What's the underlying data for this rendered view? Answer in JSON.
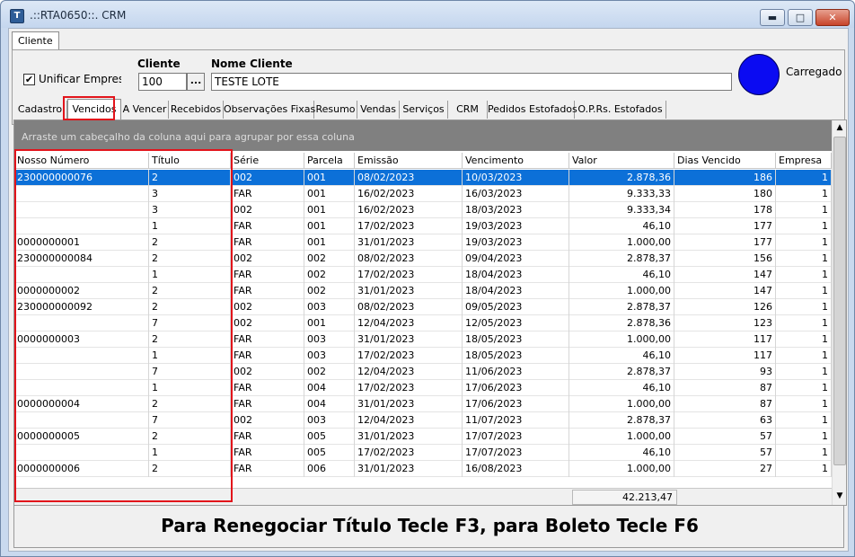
{
  "window": {
    "title": ".::RTA0650::. CRM",
    "icon": "app-logo-icon",
    "min": "▬",
    "max": "□",
    "close": "✕"
  },
  "top_tab": "Cliente",
  "form": {
    "unificar_checked": true,
    "unificar_mark": "✔",
    "unificar_label": "Unificar Empresas",
    "cliente_label": "Cliente",
    "cliente_value": "100",
    "lookup_label": "...",
    "nome_label": "Nome Cliente",
    "nome_value": "TESTE LOTE",
    "status_text": "Carregado",
    "status_color": "#0b0bf2"
  },
  "tabs": [
    "Cadastro",
    "Vencidos",
    "A Vencer",
    "Recebidos",
    "Observações Fixas",
    "Resumo",
    "Vendas",
    "Serviços",
    "CRM",
    "Pedidos Estofados",
    "O.P.Rs. Estofados"
  ],
  "active_tab": "Vencidos",
  "grid": {
    "group_hint": "Arraste um cabeçalho da coluna aqui para agrupar por essa coluna",
    "columns": [
      "Nosso Número",
      "Título",
      "Série",
      "Parcela",
      "Emissão",
      "Vencimento",
      "Valor",
      "Dias Vencido",
      "Empresa"
    ],
    "rows": [
      [
        "230000000076",
        "2",
        "002",
        "001",
        "08/02/2023",
        "10/03/2023",
        "2.878,36",
        "186",
        "1"
      ],
      [
        "",
        "3",
        "FAR",
        "001",
        "16/02/2023",
        "16/03/2023",
        "9.333,33",
        "180",
        "1"
      ],
      [
        "",
        "3",
        "002",
        "001",
        "16/02/2023",
        "18/03/2023",
        "9.333,34",
        "178",
        "1"
      ],
      [
        "",
        "1",
        "FAR",
        "001",
        "17/02/2023",
        "19/03/2023",
        "46,10",
        "177",
        "1"
      ],
      [
        "0000000001",
        "2",
        "FAR",
        "001",
        "31/01/2023",
        "19/03/2023",
        "1.000,00",
        "177",
        "1"
      ],
      [
        "230000000084",
        "2",
        "002",
        "002",
        "08/02/2023",
        "09/04/2023",
        "2.878,37",
        "156",
        "1"
      ],
      [
        "",
        "1",
        "FAR",
        "002",
        "17/02/2023",
        "18/04/2023",
        "46,10",
        "147",
        "1"
      ],
      [
        "0000000002",
        "2",
        "FAR",
        "002",
        "31/01/2023",
        "18/04/2023",
        "1.000,00",
        "147",
        "1"
      ],
      [
        "230000000092",
        "2",
        "002",
        "003",
        "08/02/2023",
        "09/05/2023",
        "2.878,37",
        "126",
        "1"
      ],
      [
        "",
        "7",
        "002",
        "001",
        "12/04/2023",
        "12/05/2023",
        "2.878,36",
        "123",
        "1"
      ],
      [
        "0000000003",
        "2",
        "FAR",
        "003",
        "31/01/2023",
        "18/05/2023",
        "1.000,00",
        "117",
        "1"
      ],
      [
        "",
        "1",
        "FAR",
        "003",
        "17/02/2023",
        "18/05/2023",
        "46,10",
        "117",
        "1"
      ],
      [
        "",
        "7",
        "002",
        "002",
        "12/04/2023",
        "11/06/2023",
        "2.878,37",
        "93",
        "1"
      ],
      [
        "",
        "1",
        "FAR",
        "004",
        "17/02/2023",
        "17/06/2023",
        "46,10",
        "87",
        "1"
      ],
      [
        "0000000004",
        "2",
        "FAR",
        "004",
        "31/01/2023",
        "17/06/2023",
        "1.000,00",
        "87",
        "1"
      ],
      [
        "",
        "7",
        "002",
        "003",
        "12/04/2023",
        "11/07/2023",
        "2.878,37",
        "63",
        "1"
      ],
      [
        "0000000005",
        "2",
        "FAR",
        "005",
        "31/01/2023",
        "17/07/2023",
        "1.000,00",
        "57",
        "1"
      ],
      [
        "",
        "1",
        "FAR",
        "005",
        "17/02/2023",
        "17/07/2023",
        "46,10",
        "57",
        "1"
      ],
      [
        "0000000006",
        "2",
        "FAR",
        "006",
        "31/01/2023",
        "16/08/2023",
        "1.000,00",
        "27",
        "1"
      ]
    ],
    "selected_row": 0,
    "total_valor": "42.213,47"
  },
  "scroll": {
    "up": "▲",
    "down": "▼"
  },
  "hint": "Para Renegociar Título Tecle F3, para Boleto Tecle F6",
  "colors": {
    "selection": "#0c70d8",
    "highlight_box": "#e2141b",
    "group_bar": "#808080"
  }
}
